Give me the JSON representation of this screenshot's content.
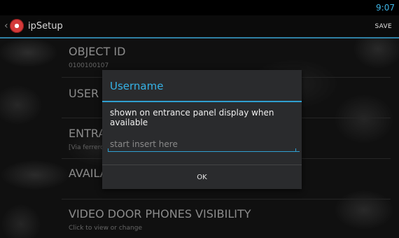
{
  "status_bar": {
    "time": "9:07"
  },
  "action_bar": {
    "title": "ipSetup",
    "save_label": "SAVE"
  },
  "settings": [
    {
      "title": "OBJECT ID",
      "subtitle": "0100100107"
    },
    {
      "title": "USER N",
      "subtitle": ""
    },
    {
      "title": "ENTRA",
      "subtitle": "[Via ferrero"
    },
    {
      "title": "AVAILA",
      "subtitle": ""
    },
    {
      "title": "VIDEO DOOR PHONES VISIBILITY",
      "subtitle": "Click to view or change"
    }
  ],
  "dialog": {
    "title": "Username",
    "message": "shown on entrance panel display when available",
    "input_placeholder": "start insert here",
    "input_value": "",
    "ok_label": "OK"
  },
  "icons": {
    "back": "chevron-left-icon",
    "app": "app-logo-icon"
  },
  "colors": {
    "accent": "#35b2e6",
    "background": "#1a1a1a"
  }
}
